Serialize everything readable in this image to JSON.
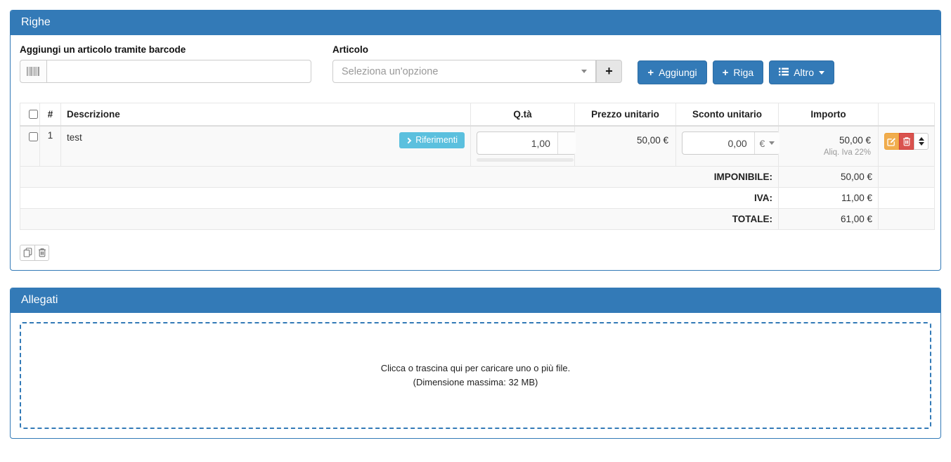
{
  "colors": {
    "primary": "#337ab7",
    "info": "#5bc0de",
    "warning": "#f0ad4e",
    "danger": "#d9534f"
  },
  "icons": {
    "plus": "+"
  },
  "righe_panel": {
    "title": "Righe",
    "barcode_field": {
      "label": "Aggiungi un articolo tramite barcode",
      "value": ""
    },
    "articolo_field": {
      "label": "Articolo",
      "placeholder": "Seleziona un'opzione"
    },
    "toolbar": {
      "aggiungi": "Aggiungi",
      "riga": "Riga",
      "altro": "Altro"
    },
    "table": {
      "headers": {
        "num": "#",
        "descrizione": "Descrizione",
        "qta": "Q.tà",
        "prezzo": "Prezzo unitario",
        "sconto": "Sconto unitario",
        "importo": "Importo"
      },
      "rows": [
        {
          "num": "1",
          "descrizione": "test",
          "badge": "Riferimenti",
          "qta": "1,00",
          "prezzo": "50,00 €",
          "sconto": "0,00",
          "sconto_unit": "€",
          "importo": "50,00 €",
          "iva_note": "Aliq. Iva 22%"
        }
      ],
      "totals": [
        {
          "label": "IMPONIBILE:",
          "value": "50,00 €"
        },
        {
          "label": "IVA:",
          "value": "11,00 €"
        },
        {
          "label": "TOTALE:",
          "value": "61,00 €"
        }
      ]
    }
  },
  "allegati_panel": {
    "title": "Allegati",
    "dropzone": {
      "line1": "Clicca o trascina qui per caricare uno o più file.",
      "line2": "(Dimensione massima: 32 MB)"
    }
  }
}
